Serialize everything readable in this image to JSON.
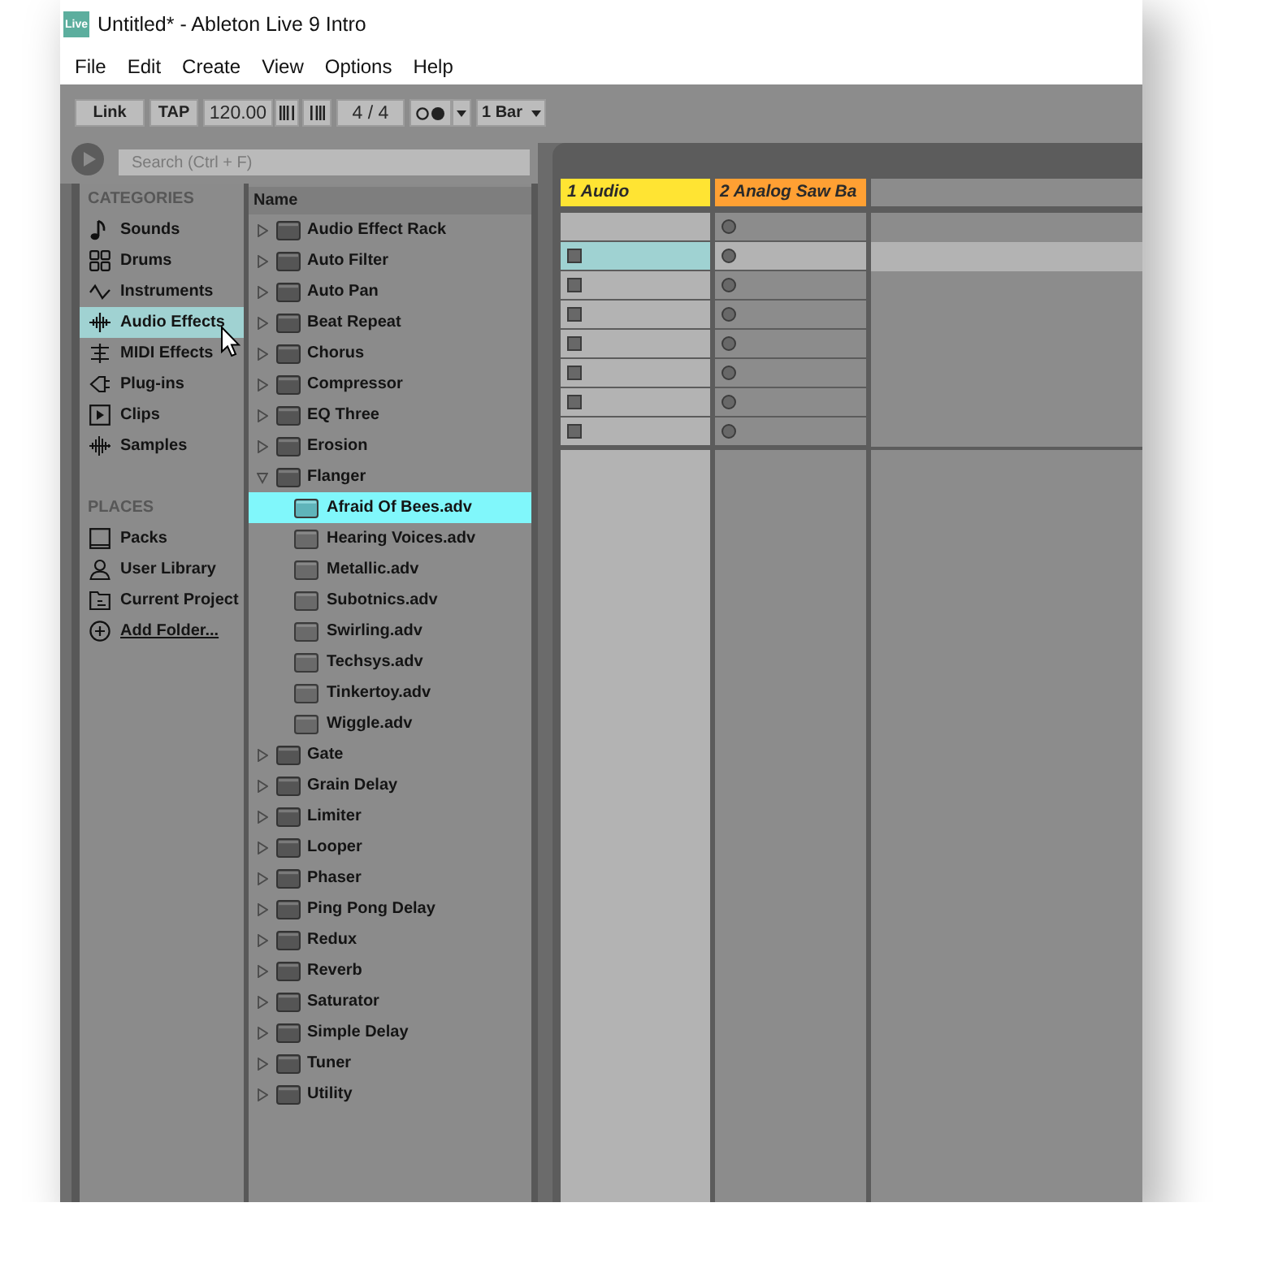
{
  "window": {
    "icon_text": "Live",
    "title": "Untitled* - Ableton Live 9 Intro"
  },
  "menu": [
    "File",
    "Edit",
    "Create",
    "View",
    "Options",
    "Help"
  ],
  "toolbar": [
    {
      "kind": "button",
      "label": "Link"
    },
    {
      "kind": "button",
      "label": "TAP"
    },
    {
      "kind": "value",
      "label": "120.00"
    },
    {
      "kind": "nudgedown"
    },
    {
      "kind": "nudgeup"
    },
    {
      "kind": "value",
      "label": "4 / 4"
    },
    {
      "kind": "metronome"
    },
    {
      "kind": "caret"
    },
    {
      "kind": "menu",
      "label": "1 Bar"
    }
  ],
  "search": {
    "placeholder": "Search (Ctrl + F)"
  },
  "categories": {
    "title": "CATEGORIES",
    "items": [
      {
        "label": "Sounds",
        "selected": false
      },
      {
        "label": "Drums",
        "selected": false
      },
      {
        "label": "Instruments",
        "selected": false
      },
      {
        "label": "Audio Effects",
        "selected": true
      },
      {
        "label": "MIDI Effects",
        "selected": false
      },
      {
        "label": "Plug-ins",
        "selected": false
      },
      {
        "label": "Clips",
        "selected": false
      },
      {
        "label": "Samples",
        "selected": false
      }
    ]
  },
  "places": {
    "title": "PLACES",
    "items": [
      {
        "label": "Packs",
        "kind": "place",
        "selected": false
      },
      {
        "label": "User Library",
        "kind": "place",
        "selected": false
      },
      {
        "label": "Current Project",
        "kind": "place",
        "selected": false
      },
      {
        "label": "Add Folder...",
        "kind": "link",
        "selected": false
      }
    ]
  },
  "files": {
    "column": "Name",
    "items": [
      {
        "name": "Audio Effect Rack",
        "expanded": false,
        "selected": false
      },
      {
        "name": "Auto Filter",
        "expanded": false,
        "selected": false
      },
      {
        "name": "Auto Pan",
        "expanded": false,
        "selected": false
      },
      {
        "name": "Beat Repeat",
        "expanded": false,
        "selected": false
      },
      {
        "name": "Chorus",
        "expanded": false,
        "selected": false
      },
      {
        "name": "Compressor",
        "expanded": false,
        "selected": false
      },
      {
        "name": "EQ Three",
        "expanded": false,
        "selected": false
      },
      {
        "name": "Erosion",
        "expanded": false,
        "selected": false
      },
      {
        "name": "Flanger",
        "expanded": true,
        "selected": false,
        "children": [
          {
            "name": "Afraid Of Bees.adv",
            "selected": true
          },
          {
            "name": "Hearing Voices.adv",
            "selected": false
          },
          {
            "name": "Metallic.adv",
            "selected": false
          },
          {
            "name": "Subotnics.adv",
            "selected": false
          },
          {
            "name": "Swirling.adv",
            "selected": false
          },
          {
            "name": "Techsys.adv",
            "selected": false
          },
          {
            "name": "Tinkertoy.adv",
            "selected": false
          },
          {
            "name": "Wiggle.adv",
            "selected": false
          }
        ]
      },
      {
        "name": "Gate",
        "expanded": false,
        "selected": false
      },
      {
        "name": "Grain Delay",
        "expanded": false,
        "selected": false
      },
      {
        "name": "Limiter",
        "expanded": false,
        "selected": false
      },
      {
        "name": "Looper",
        "expanded": false,
        "selected": false
      },
      {
        "name": "Phaser",
        "expanded": false,
        "selected": false
      },
      {
        "name": "Ping Pong Delay",
        "expanded": false,
        "selected": false
      },
      {
        "name": "Redux",
        "expanded": false,
        "selected": false
      },
      {
        "name": "Reverb",
        "expanded": false,
        "selected": false
      },
      {
        "name": "Saturator",
        "expanded": false,
        "selected": false
      },
      {
        "name": "Simple Delay",
        "expanded": false,
        "selected": false
      },
      {
        "name": "Tuner",
        "expanded": false,
        "selected": false
      },
      {
        "name": "Utility",
        "expanded": false,
        "selected": false
      }
    ]
  },
  "session": {
    "tracks": [
      {
        "name": "1 Audio",
        "color": "#ffe433",
        "selected": true,
        "slots": [
          {
            "kind": "empty"
          },
          {
            "kind": "stop"
          },
          {
            "kind": "stop"
          },
          {
            "kind": "stop"
          },
          {
            "kind": "stop"
          },
          {
            "kind": "stop"
          },
          {
            "kind": "stop"
          },
          {
            "kind": "stop"
          }
        ]
      },
      {
        "name": "2 Analog Saw Ba",
        "color": "#ffa033",
        "selected": false,
        "slots": [
          {
            "kind": "record"
          },
          {
            "kind": "record"
          },
          {
            "kind": "record"
          },
          {
            "kind": "record"
          },
          {
            "kind": "record"
          },
          {
            "kind": "record"
          },
          {
            "kind": "record"
          },
          {
            "kind": "record"
          }
        ]
      }
    ],
    "scenes": [
      {
        "selected": false
      },
      {
        "selected": true
      },
      {
        "selected": false
      },
      {
        "selected": false
      },
      {
        "selected": false
      },
      {
        "selected": false
      },
      {
        "selected": false
      },
      {
        "selected": false
      }
    ]
  }
}
